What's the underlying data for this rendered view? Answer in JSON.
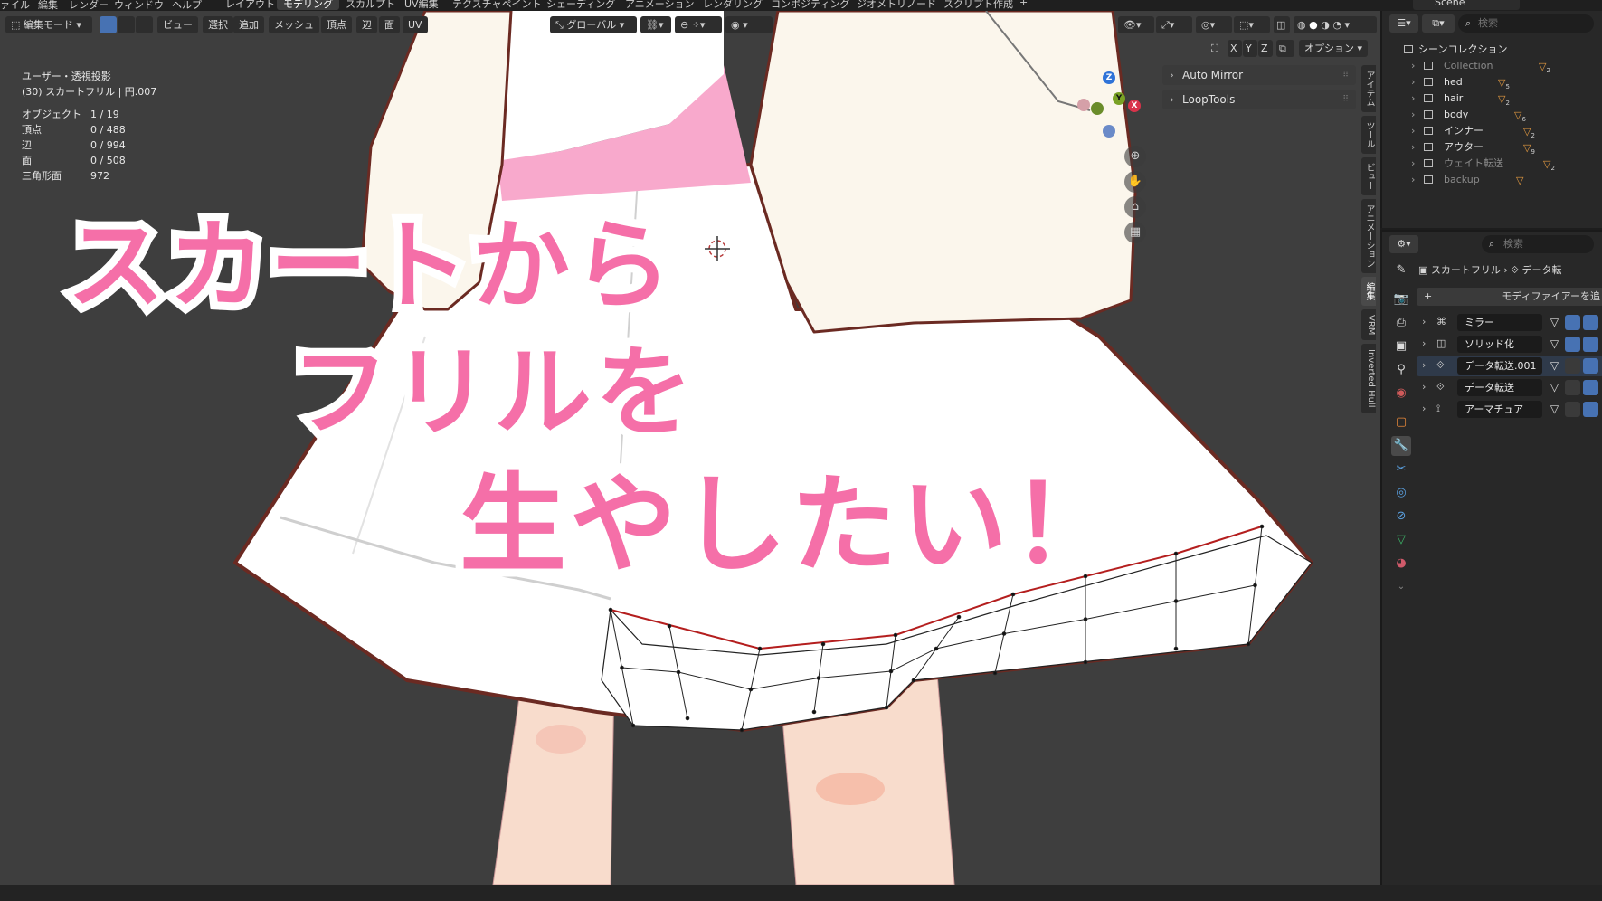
{
  "menu": [
    "ァイル",
    "編集",
    "レンダー",
    "ウィンドウ",
    "ヘルプ"
  ],
  "workspaces": {
    "tabs": [
      "レイアウト",
      "モデリング",
      "スカルプト",
      "UV編集",
      "テクスチャペイント",
      "シェーディング",
      "アニメーション",
      "レンダリング",
      "コンポジティング",
      "ジオメトリノード",
      "スクリプト作成"
    ],
    "active": "モデリング",
    "add": "+"
  },
  "scene": {
    "name": "Scene"
  },
  "viewport_header": {
    "mode": "編集モード",
    "menus": [
      "ビュー",
      "選択",
      "追加",
      "メッシュ",
      "頂点",
      "辺",
      "面",
      "UV"
    ],
    "orientation": "グローバル",
    "axes": [
      "X",
      "Y",
      "Z"
    ],
    "options": "オプション"
  },
  "viewport_info": {
    "view": "ユーザー・透視投影",
    "object": "(30) スカートフリル | 円.007",
    "stats": [
      {
        "label": "オブジェクト",
        "value": "1 / 19"
      },
      {
        "label": "頂点",
        "value": "0 / 488"
      },
      {
        "label": "辺",
        "value": "0 / 994"
      },
      {
        "label": "面",
        "value": "0 / 508"
      },
      {
        "label": "三角形面",
        "value": "972"
      }
    ]
  },
  "gizmo": {
    "z": "Z",
    "y": "Y",
    "x": "X"
  },
  "npanel": {
    "items": [
      "Auto Mirror",
      "LoopTools"
    ],
    "tabs": [
      "アイテム",
      "ツール",
      "ビュー",
      "アニメーション",
      "編集",
      "VRM",
      "Inverted Hull"
    ],
    "active_tab": "編集"
  },
  "caption": {
    "line1": "スカートから",
    "line2": "フリルを",
    "line3": "生やしたい！",
    "fill_color": "#f56fa8"
  },
  "outliner": {
    "search_placeholder": "検索",
    "root": "シーンコレクション",
    "collections": [
      {
        "name": "Collection",
        "dim": true,
        "badge": "2"
      },
      {
        "name": "hed",
        "dim": false,
        "badge": "5"
      },
      {
        "name": "hair",
        "dim": false,
        "badge": "2"
      },
      {
        "name": "body",
        "dim": false,
        "badge": "6"
      },
      {
        "name": "インナー",
        "dim": false,
        "badge": "2"
      },
      {
        "name": "アウター",
        "dim": false,
        "badge": "9"
      },
      {
        "name": "ウェイト転送",
        "dim": true,
        "badge": "2"
      },
      {
        "name": "backup",
        "dim": true,
        "badge": ""
      }
    ]
  },
  "properties": {
    "search_placeholder": "検索",
    "breadcrumb_object": "スカートフリル",
    "breadcrumb_data": "データ転",
    "add_modifier": "モディファイアーを追",
    "modifiers": [
      {
        "name": "ミラー",
        "icon": "mirror-icon",
        "active": false
      },
      {
        "name": "ソリッド化",
        "icon": "solidify-icon",
        "active": false
      },
      {
        "name": "データ転送.001",
        "icon": "data-transfer-icon",
        "active": true
      },
      {
        "name": "データ転送",
        "icon": "data-transfer-icon",
        "active": false
      },
      {
        "name": "アーマチュア",
        "icon": "armature-icon",
        "active": false
      }
    ]
  },
  "colors": {
    "viewport_bg": "#3e3e3e",
    "accent": "#4772b3",
    "skirt": "#ffffff",
    "outline": "#6b2a22",
    "pink_band": "#f8a9cc",
    "skin": "#f8dccc",
    "jacket": "#fbf6ec"
  }
}
